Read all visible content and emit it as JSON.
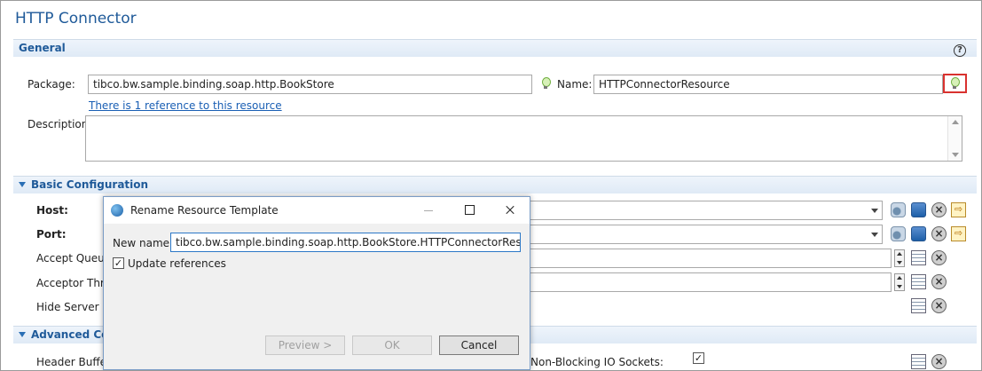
{
  "editor": {
    "title": "HTTP Connector"
  },
  "general": {
    "header": "General",
    "package_label": "Package:",
    "package_value": "tibco.bw.sample.binding.soap.http.BookStore",
    "name_label": "Name:",
    "name_value": "HTTPConnectorResource",
    "reference_link": "There is 1 reference to this resource",
    "description_label": "Description:",
    "help_glyph": "?"
  },
  "basic": {
    "header": "Basic Configuration",
    "host_label": "Host:",
    "port_label": "Port:",
    "accept_queue_label": "Accept Queue",
    "acceptor_threads_label": "Acceptor Thre",
    "hide_server_label": "Hide Server Im"
  },
  "advanced": {
    "header": "Advanced Con",
    "header_buffer_label": "Header Buffer",
    "non_blocking_label": "Non-Blocking IO Sockets:",
    "non_blocking_checked": true
  },
  "dialog": {
    "title": "Rename Resource Template",
    "new_name_label": "New name:",
    "new_name_value": "tibco.bw.sample.binding.soap.http.BookStore.HTTPConnectorResource",
    "update_refs_label": "Update references",
    "update_refs_checked": true,
    "preview_button": "Preview >",
    "ok_button": "OK",
    "cancel_button": "Cancel"
  }
}
